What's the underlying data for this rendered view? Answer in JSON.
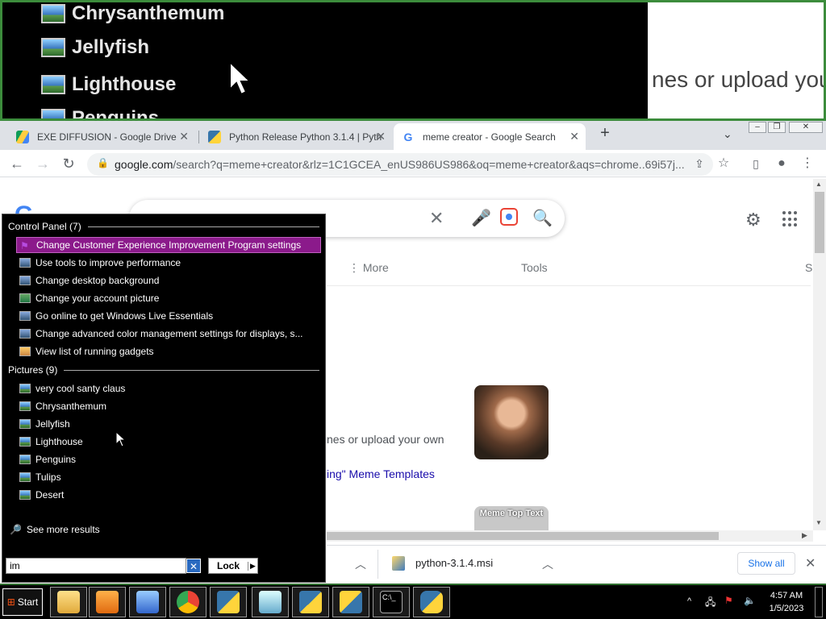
{
  "magnifier": {
    "items": [
      "Chrysanthemum",
      "Jellyfish",
      "Lighthouse",
      "Penguins"
    ],
    "right_text": "nes or upload you"
  },
  "browser": {
    "tabs": [
      {
        "title": "EXE DIFFUSION - Google Drive",
        "favicon": "google-drive-icon"
      },
      {
        "title": "Python Release Python 3.1.4 | Pyth",
        "favicon": "python-icon"
      },
      {
        "title": "meme creator - Google Search",
        "favicon": "google-icon",
        "active": true
      }
    ],
    "address_host": "google.com",
    "address_path": "/search?q=meme+creator&rlz=1C1GCEA_enUS986US986&oq=meme+creator&aqs=chrome..69i57j..."
  },
  "page": {
    "logo_fragment": "G",
    "nav_more": "⋮ More",
    "nav_tools": "Tools",
    "nav_s": "S",
    "snippet": "nes or upload your own",
    "link": "ing\" Meme Templates",
    "meme_top_text": "Meme Top Text"
  },
  "downloads": {
    "file_name": "python-3.1.4.msi",
    "show_all": "Show all"
  },
  "start_menu": {
    "control_panel_heading": "Control Panel (7)",
    "control_panel_items": [
      "Change Customer Experience Improvement Program settings",
      "Use tools to improve performance",
      "Change desktop background",
      "Change your account picture",
      "Go online to get Windows Live Essentials",
      "Change advanced color management settings for displays, s...",
      "View list of running gadgets"
    ],
    "pictures_heading": "Pictures (9)",
    "pictures_items": [
      "very cool santy claus",
      "Chrysanthemum",
      "Jellyfish",
      "Lighthouse",
      "Penguins",
      "Tulips",
      "Desert"
    ],
    "see_more": "See more results",
    "search_value": "im",
    "lock_label": "Lock"
  },
  "taskbar": {
    "start_label": "Start",
    "time": "4:57 AM",
    "date": "1/5/2023"
  }
}
